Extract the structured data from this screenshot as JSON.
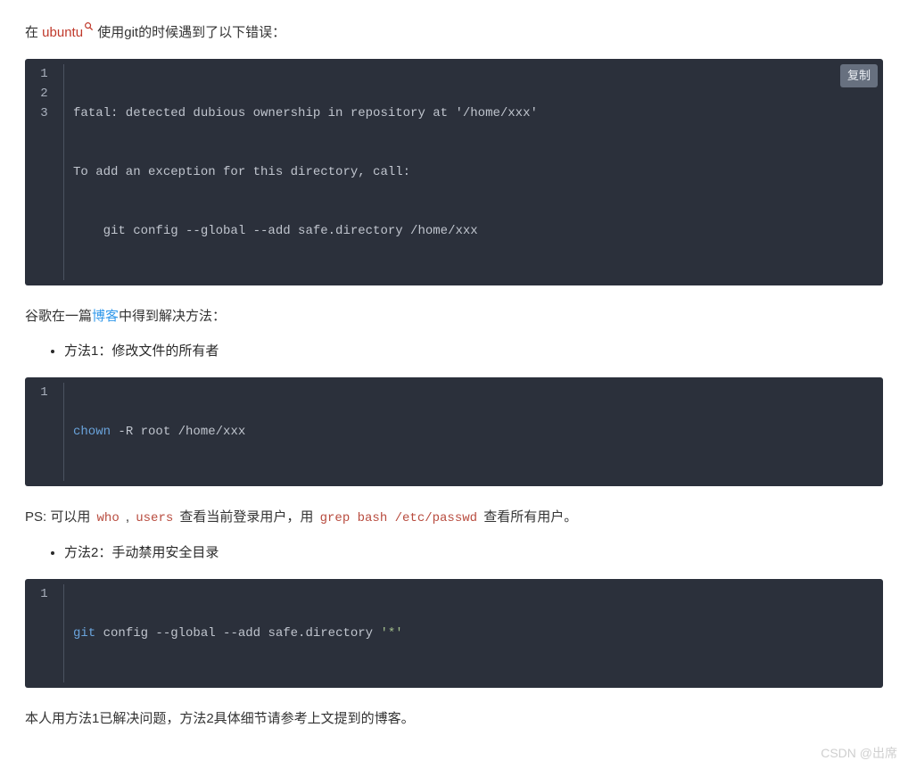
{
  "intro": {
    "before": "在 ",
    "link_text": "ubuntu",
    "after": " 使用git的时候遇到了以下错误："
  },
  "codeblock1": {
    "copy_label": "复制",
    "lines": [
      "fatal: detected dubious ownership in repository at '/home/xxx'",
      "To add an exception for this directory, call:",
      "    git config --global --add safe.directory /home/xxx"
    ],
    "line_numbers": [
      "1",
      "2",
      "3"
    ]
  },
  "solution_line": {
    "before": "谷歌在一篇",
    "link_text": "博客",
    "after": "中得到解决方法："
  },
  "method1": "方法1：修改文件的所有者",
  "codeblock2": {
    "line_number": "1",
    "kw": "chown",
    "rest": " -R root /home/xxx"
  },
  "ps_line": {
    "p1": "PS: 可以用 ",
    "code1": "who",
    "sep": " , ",
    "code2": "users",
    "p2": " 查看当前登录用户，用 ",
    "code3": "grep bash /etc/passwd",
    "p3": " 查看所有用户。"
  },
  "method2": "方法2：手动禁用安全目录",
  "codeblock3": {
    "line_number": "1",
    "kw": "git",
    "rest": " config --global --add safe.directory ",
    "str": "'*'"
  },
  "conclusion": "本人用方法1已解决问题，方法2具体细节请参考上文提到的博客。",
  "watermark": "CSDN @出席"
}
